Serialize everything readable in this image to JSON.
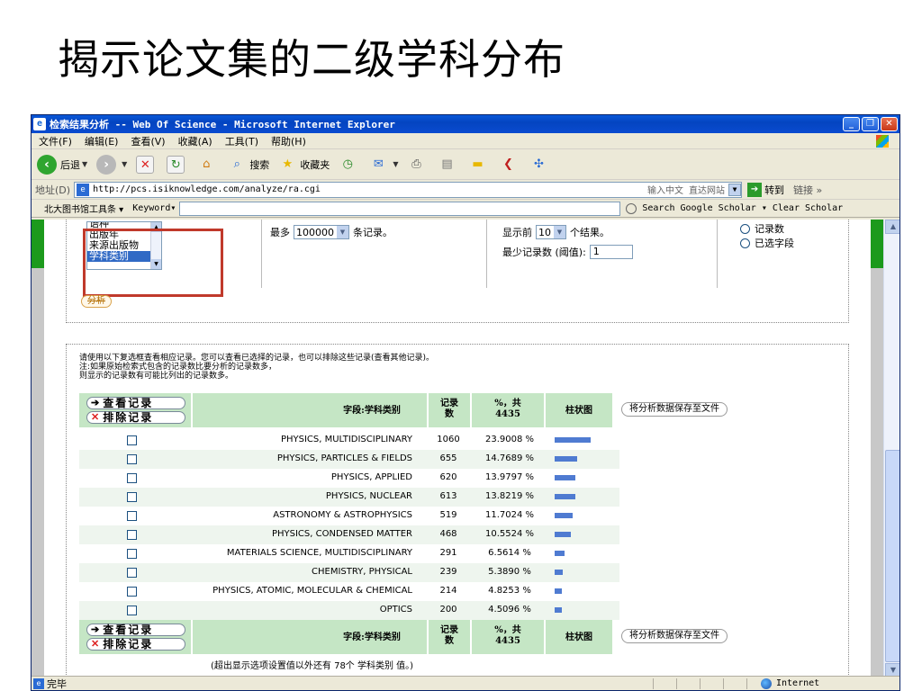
{
  "slide": {
    "title": "揭示论文集的二级学科分布"
  },
  "window": {
    "title": "检索结果分析 -- Web Of Science - Microsoft Internet Explorer",
    "minimize": "_",
    "maximize": "❐",
    "close": "✕"
  },
  "menu": [
    "文件(F)",
    "编辑(E)",
    "查看(V)",
    "收藏(A)",
    "工具(T)",
    "帮助(H)"
  ],
  "toolbar": {
    "back_label": "后退",
    "search_label": "搜索",
    "favorites_label": "收藏夹"
  },
  "address": {
    "label": "地址(D)",
    "url": "http://pcs.isiknowledge.com/analyze/ra.cgi",
    "hint": "输入中文 直达网站",
    "go_label": "转到",
    "links_label": "链接 »"
  },
  "library_bar": {
    "label": "北大图书馆工具条 ▾",
    "keyword_label": "Keyword▾",
    "google_scholar": "Search Google Scholar  ▾ Clear  Scholar"
  },
  "options": {
    "listbox_items": [
      "语种",
      "出版年",
      "来源出版物",
      "学科类别"
    ],
    "max_prefix": "最多",
    "max_value": "100000",
    "max_suffix": "条记录。",
    "show_prefix": "显示前",
    "show_value": "10",
    "show_suffix": "个结果。",
    "min_label": "最少记录数 (阈值):",
    "min_value": "1",
    "radio_records": "记录数",
    "radio_selected": "已选字段",
    "analyze_button": "分析"
  },
  "instructions": [
    "请使用以下复选框查看相应记录。您可以查看已选择的记录，也可以排除这些记录(查看其他记录)。",
    "注:如果原始检索式包含的记录数比要分析的记录数多，",
    "则显示的记录数有可能比列出的记录数多。"
  ],
  "table_header": {
    "view_label": "查看记录",
    "exclude_label": "排除记录",
    "field_label": "字段:学科类别",
    "count_label_line1": "记录",
    "count_label_line2": "数",
    "pct_label_line1": "%，共",
    "pct_label_line2": "4435",
    "bar_label": "柱状图",
    "save_label": "将分析数据保存至文件"
  },
  "rows": [
    {
      "field": "PHYSICS, MULTIDISCIPLINARY",
      "count": "1060",
      "pct": "23.9008 %",
      "pct_value": 23.9008
    },
    {
      "field": "PHYSICS, PARTICLES & FIELDS",
      "count": "655",
      "pct": "14.7689 %",
      "pct_value": 14.7689
    },
    {
      "field": "PHYSICS, APPLIED",
      "count": "620",
      "pct": "13.9797 %",
      "pct_value": 13.9797
    },
    {
      "field": "PHYSICS, NUCLEAR",
      "count": "613",
      "pct": "13.8219 %",
      "pct_value": 13.8219
    },
    {
      "field": "ASTRONOMY & ASTROPHYSICS",
      "count": "519",
      "pct": "11.7024 %",
      "pct_value": 11.7024
    },
    {
      "field": "PHYSICS, CONDENSED MATTER",
      "count": "468",
      "pct": "10.5524 %",
      "pct_value": 10.5524
    },
    {
      "field": "MATERIALS SCIENCE, MULTIDISCIPLINARY",
      "count": "291",
      "pct": "6.5614 %",
      "pct_value": 6.5614
    },
    {
      "field": "CHEMISTRY, PHYSICAL",
      "count": "239",
      "pct": "5.3890 %",
      "pct_value": 5.389
    },
    {
      "field": "PHYSICS, ATOMIC, MOLECULAR & CHEMICAL",
      "count": "214",
      "pct": "4.8253 %",
      "pct_value": 4.8253
    },
    {
      "field": "OPTICS",
      "count": "200",
      "pct": "4.5096 %",
      "pct_value": 4.5096
    }
  ],
  "footer_note": "(超出显示选项设置值以外还有 78个 学科类别 值。)",
  "status": {
    "done": "完毕",
    "zone": "Internet"
  },
  "colors": {
    "bar": "#4f7bd1",
    "highlight_box": "#c0392b",
    "header_bg": "#c5e6c5",
    "side_green": "#1c9a1c"
  }
}
